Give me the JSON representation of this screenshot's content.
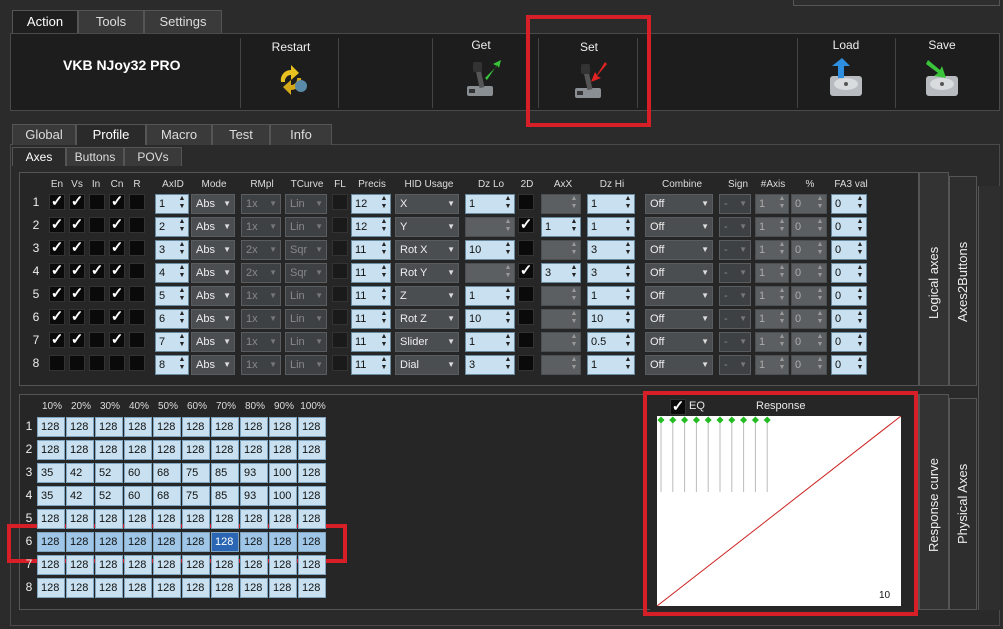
{
  "menu_tabs": [
    {
      "label": "Action",
      "active": true
    },
    {
      "label": "Tools"
    },
    {
      "label": "Settings"
    }
  ],
  "device_name": "VKB NJoy32 PRO",
  "ribbon": {
    "restart": "Restart",
    "get": "Get",
    "set": "Set",
    "load": "Load",
    "save": "Save"
  },
  "profile_tabs": [
    {
      "label": "Global"
    },
    {
      "label": "Profile",
      "active": true
    },
    {
      "label": "Macro"
    },
    {
      "label": "Test"
    },
    {
      "label": "Info"
    }
  ],
  "sub_tabs": [
    {
      "label": "Axes",
      "active": true
    },
    {
      "label": "Buttons"
    },
    {
      "label": "POVs"
    }
  ],
  "axes_headers": {
    "en": "En",
    "vs": "Vs",
    "in": "In",
    "cn": "Cn",
    "r": "R",
    "axid": "AxID",
    "mode": "Mode",
    "rmpl": "RMpl",
    "tcurve": "TCurve",
    "fl": "FL",
    "precis": "Precis",
    "hid": "HID Usage",
    "dzlo": "Dz Lo",
    "twod": "2D",
    "axx": "AxX",
    "dzhi": "Dz Hi",
    "combine": "Combine",
    "sign": "Sign",
    "naxis": "#Axis",
    "pct": "%",
    "fa3": "FA3 val"
  },
  "axes_rows": [
    {
      "num": "1",
      "en": true,
      "vs": true,
      "in": false,
      "cn": true,
      "r": false,
      "axid": "1",
      "mode": "Abs",
      "rmpl": "1x",
      "tcurve": "Lin",
      "precis": "12",
      "hid": "X",
      "dzlo": "1",
      "twod": false,
      "axx": "",
      "dzhi": "1",
      "combine": "Off",
      "sign": "-",
      "naxis": "1",
      "pct": "0",
      "fa3": "0"
    },
    {
      "num": "2",
      "en": true,
      "vs": true,
      "in": false,
      "cn": true,
      "r": false,
      "axid": "2",
      "mode": "Abs",
      "rmpl": "1x",
      "tcurve": "Lin",
      "precis": "12",
      "hid": "Y",
      "dzlo": "",
      "twod": true,
      "axx": "1",
      "dzhi": "1",
      "combine": "Off",
      "sign": "-",
      "naxis": "1",
      "pct": "0",
      "fa3": "0"
    },
    {
      "num": "3",
      "en": true,
      "vs": true,
      "in": false,
      "cn": true,
      "r": false,
      "axid": "3",
      "mode": "Abs",
      "rmpl": "2x",
      "tcurve": "Sqr",
      "precis": "11",
      "hid": "Rot X",
      "dzlo": "10",
      "twod": false,
      "axx": "",
      "dzhi": "3",
      "combine": "Off",
      "sign": "-",
      "naxis": "1",
      "pct": "0",
      "fa3": "0"
    },
    {
      "num": "4",
      "en": true,
      "vs": true,
      "in": true,
      "cn": true,
      "r": false,
      "axid": "4",
      "mode": "Abs",
      "rmpl": "2x",
      "tcurve": "Sqr",
      "precis": "11",
      "hid": "Rot Y",
      "dzlo": "",
      "twod": true,
      "axx": "3",
      "dzhi": "3",
      "combine": "Off",
      "sign": "-",
      "naxis": "1",
      "pct": "0",
      "fa3": "0"
    },
    {
      "num": "5",
      "en": true,
      "vs": true,
      "in": false,
      "cn": true,
      "r": false,
      "axid": "5",
      "mode": "Abs",
      "rmpl": "1x",
      "tcurve": "Lin",
      "precis": "11",
      "hid": "Z",
      "dzlo": "1",
      "twod": false,
      "axx": "",
      "dzhi": "1",
      "combine": "Off",
      "sign": "-",
      "naxis": "1",
      "pct": "0",
      "fa3": "0"
    },
    {
      "num": "6",
      "en": true,
      "vs": true,
      "in": false,
      "cn": true,
      "r": false,
      "axid": "6",
      "mode": "Abs",
      "rmpl": "1x",
      "tcurve": "Lin",
      "precis": "11",
      "hid": "Rot Z",
      "dzlo": "10",
      "twod": false,
      "axx": "",
      "dzhi": "10",
      "combine": "Off",
      "sign": "-",
      "naxis": "1",
      "pct": "0",
      "fa3": "0"
    },
    {
      "num": "7",
      "en": true,
      "vs": true,
      "in": false,
      "cn": true,
      "r": false,
      "axid": "7",
      "mode": "Abs",
      "rmpl": "1x",
      "tcurve": "Lin",
      "precis": "11",
      "hid": "Slider",
      "dzlo": "1",
      "twod": false,
      "axx": "",
      "dzhi": "0.5",
      "combine": "Off",
      "sign": "-",
      "naxis": "1",
      "pct": "0",
      "fa3": "0"
    },
    {
      "num": "8",
      "en": false,
      "vs": false,
      "in": false,
      "cn": false,
      "r": false,
      "axid": "8",
      "mode": "Abs",
      "rmpl": "1x",
      "tcurve": "Lin",
      "precis": "11",
      "hid": "Dial",
      "dzlo": "3",
      "twod": false,
      "axx": "",
      "dzhi": "1",
      "combine": "Off",
      "sign": "-",
      "naxis": "1",
      "pct": "0",
      "fa3": "0"
    }
  ],
  "side_labels": {
    "logical_axes": "Logical axes",
    "axes2buttons": "Axes2Buttons",
    "response_curve": "Response curve",
    "physical_axes": "Physical Axes"
  },
  "curve_headers": [
    "10%",
    "20%",
    "30%",
    "40%",
    "50%",
    "60%",
    "70%",
    "80%",
    "90%",
    "100%"
  ],
  "curve_rows": [
    {
      "num": "1",
      "vals": [
        "128",
        "128",
        "128",
        "128",
        "128",
        "128",
        "128",
        "128",
        "128",
        "128"
      ]
    },
    {
      "num": "2",
      "vals": [
        "128",
        "128",
        "128",
        "128",
        "128",
        "128",
        "128",
        "128",
        "128",
        "128"
      ]
    },
    {
      "num": "3",
      "vals": [
        "35",
        "42",
        "52",
        "60",
        "68",
        "75",
        "85",
        "93",
        "100",
        "128"
      ]
    },
    {
      "num": "4",
      "vals": [
        "35",
        "42",
        "52",
        "60",
        "68",
        "75",
        "85",
        "93",
        "100",
        "128"
      ]
    },
    {
      "num": "5",
      "vals": [
        "128",
        "128",
        "128",
        "128",
        "128",
        "128",
        "128",
        "128",
        "128",
        "128"
      ]
    },
    {
      "num": "6",
      "vals": [
        "128",
        "128",
        "128",
        "128",
        "128",
        "128",
        "128",
        "128",
        "128",
        "128"
      ],
      "selected": true,
      "focus_index": 6
    },
    {
      "num": "7",
      "vals": [
        "128",
        "128",
        "128",
        "128",
        "128",
        "128",
        "128",
        "128",
        "128",
        "128"
      ]
    },
    {
      "num": "8",
      "vals": [
        "128",
        "128",
        "128",
        "128",
        "128",
        "128",
        "128",
        "128",
        "128",
        "128"
      ]
    }
  ],
  "response": {
    "eq_label": "EQ",
    "eq_checked": true,
    "title": "Response",
    "corner_value": "10",
    "line_color": "#cc2222",
    "point_color": "#22bb22"
  },
  "highlight_color": "#d61f26"
}
